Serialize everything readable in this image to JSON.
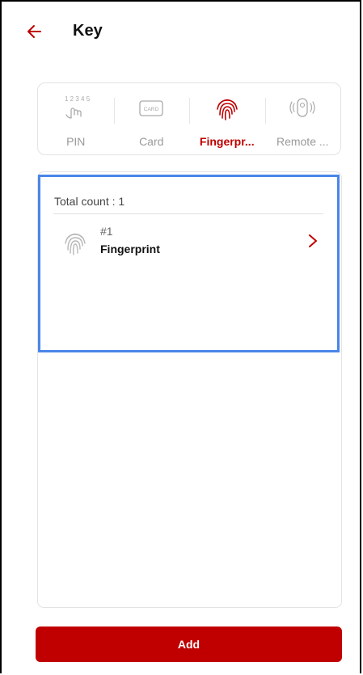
{
  "header": {
    "title": "Key",
    "back_icon": "arrow-left-icon"
  },
  "tabs": [
    {
      "label": "PIN",
      "icon": "pin-keypad-icon",
      "icon_text": "1 2 3 4 5 6",
      "active": false
    },
    {
      "label": "Card",
      "icon": "card-icon",
      "icon_text": "CARD",
      "active": false
    },
    {
      "label": "Fingerpr...",
      "icon": "fingerprint-icon",
      "active": true
    },
    {
      "label": "Remote ...",
      "icon": "remote-icon",
      "active": false
    }
  ],
  "list": {
    "total_label": "Total count : 1",
    "items": [
      {
        "number": "#1",
        "name": "Fingerprint",
        "icon": "fingerprint-icon"
      }
    ]
  },
  "footer": {
    "add_label": "Add"
  },
  "colors": {
    "accent": "#c00000",
    "selection": "#4a86e8",
    "muted": "#9a9a9a"
  }
}
